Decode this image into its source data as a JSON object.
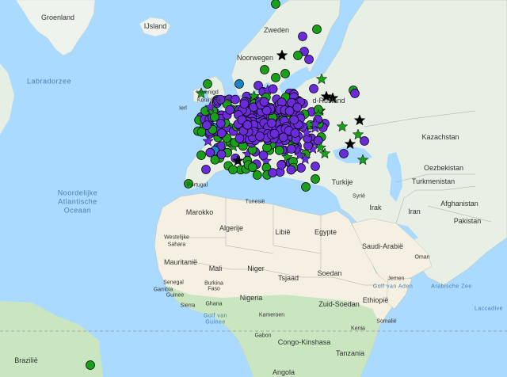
{
  "colors": {
    "water": "#aadaff",
    "land_north": "#e8efe4",
    "land_desert": "#f5f0e1",
    "land_green": "#c9e6c1",
    "border": "#9e9e9e",
    "marker_green": "#1a9f1a",
    "marker_purple": "#6a2bd9",
    "marker_black": "#000000",
    "marker_blue": "#1a86c9"
  },
  "labels": {
    "groenland": "Groenland",
    "ijsland": "IJsland",
    "zweden": "Zweden",
    "noorwegen": "Noorwegen",
    "labradorzee": "Labradorzee",
    "verenigd": "Verenigd",
    "koninkrijk": "Koninkrijk",
    "ierland": "Ierl",
    "frankrijk": "rijk",
    "rusland": "d-Rusland",
    "kazachstan": "Kazachstan",
    "oezbekistan": "Oezbekistan",
    "turkmenistan": "Turkmenistan",
    "afghanistan": "Afghanistan",
    "pakistan": "Pakistan",
    "iran": "Iran",
    "irak": "Irak",
    "syrie": "Syrië",
    "turkije": "Turkije",
    "noordelijke": "Noordelijke",
    "atlantische": "Atlantische",
    "oceaan": "Oceaan",
    "portugal": "Portugal",
    "tunesie": "Tunesië",
    "marokko": "Marokko",
    "algerije": "Algerije",
    "libie": "Libië",
    "egypte": "Egypte",
    "westelijke": "Westelijke",
    "sahara": "Sahara",
    "mauritanie": "Mauritanië",
    "mali": "Mali",
    "niger": "Niger",
    "tsjaad": "Tsjaad",
    "soedan": "Soedan",
    "saudi": "Saudi-Arabië",
    "oman": "Oman",
    "jemen": "Jemen",
    "golf_aden": "Golf van Aden",
    "arabische_zee": "Arabische Zee",
    "senegal": "Senegal",
    "guinee": "Guinee",
    "burkina1": "Burkina",
    "burkina2": "Faso",
    "ghana": "Ghana",
    "nigeria": "Nigeria",
    "zuid_soedan": "Zuid-Soedan",
    "ethiopie": "Ethiopië",
    "somalie": "Somalië",
    "kenia": "Kenia",
    "golf_guinee1": "Golf van",
    "golf_guinee2": "Guinee",
    "gabon": "Gabon",
    "congo": "Congo-Kinshasa",
    "tanzania": "Tanzania",
    "angola": "Angola",
    "brazilie": "Brazilië",
    "laccadiven": "Laccadive",
    "sierra": "Sierra",
    "kameroen": "Kameroen",
    "gambia": "Gambia"
  },
  "legend_markers": {
    "green_circle": "green-circle-marker",
    "purple_circle": "purple-circle-marker",
    "green_star": "green-star-marker",
    "purple_star": "purple-star-marker",
    "black_star": "black-star-marker",
    "blue_circle": "blue-circle-marker"
  }
}
